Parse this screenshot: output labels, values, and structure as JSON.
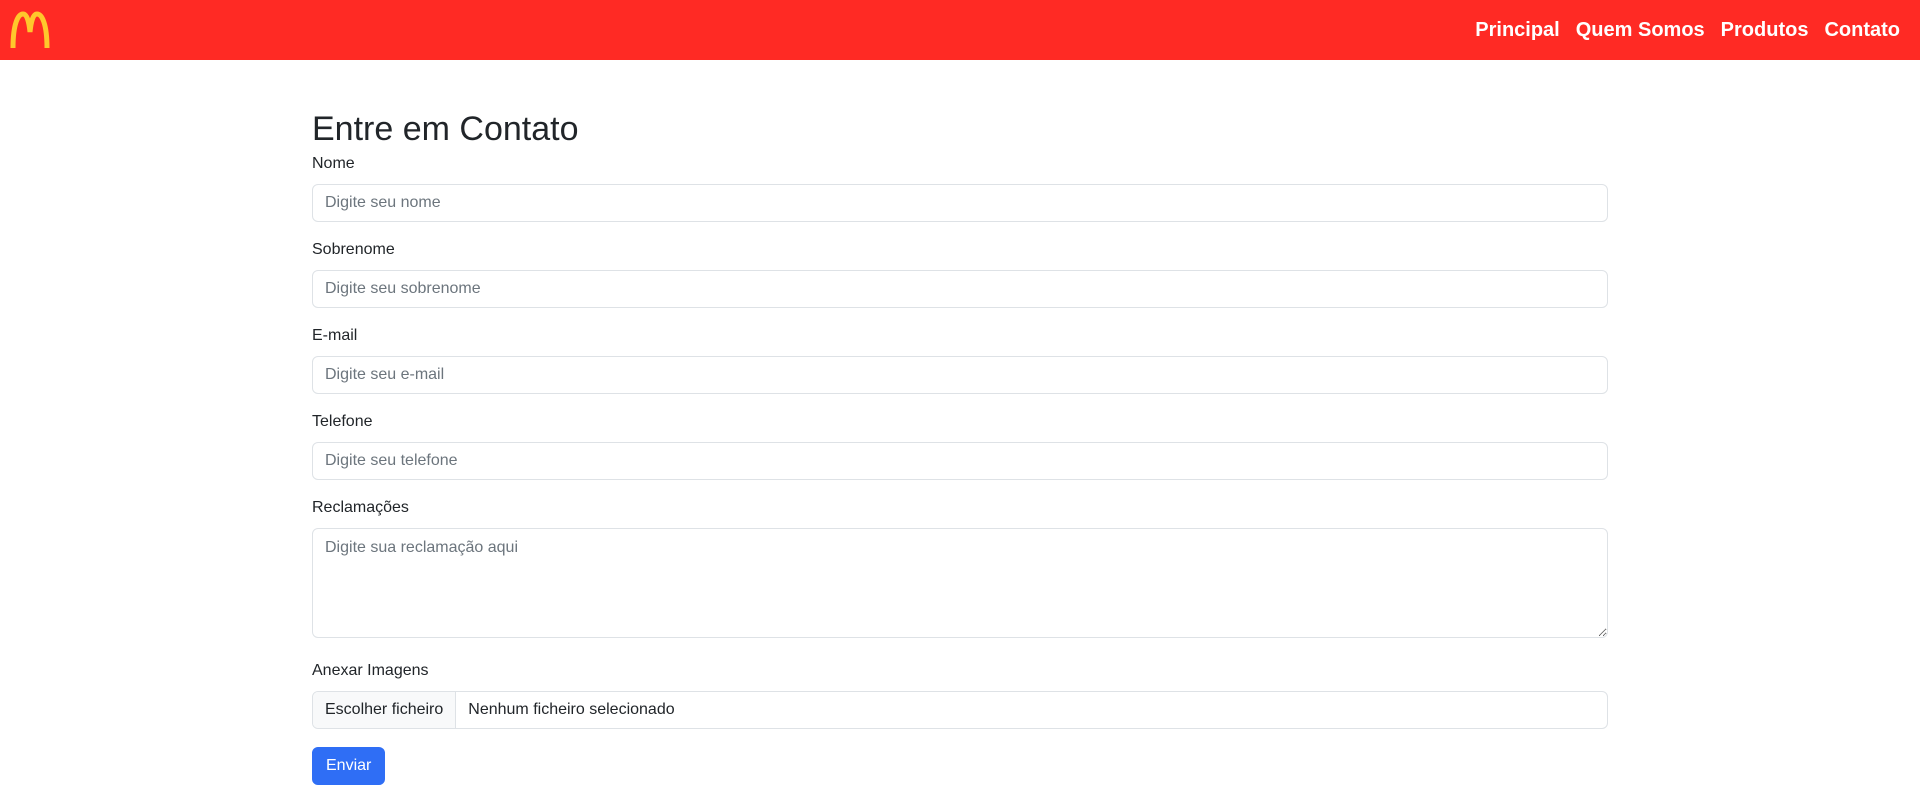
{
  "colors": {
    "navbar_bg": "#ff2a24",
    "logo": "#ffc72c",
    "primary_button": "#2f6ef5"
  },
  "navbar": {
    "logo_icon": "mcdonalds-arches-icon",
    "links": [
      "Principal",
      "Quem Somos",
      "Produtos",
      "Contato"
    ]
  },
  "form": {
    "title": "Entre em Contato",
    "fields": {
      "nome": {
        "label": "Nome",
        "placeholder": "Digite seu nome"
      },
      "sobrenome": {
        "label": "Sobrenome",
        "placeholder": "Digite seu sobrenome"
      },
      "email": {
        "label": "E-mail",
        "placeholder": "Digite seu e-mail"
      },
      "telefone": {
        "label": "Telefone",
        "placeholder": "Digite seu telefone"
      },
      "reclamacoes": {
        "label": "Reclamações",
        "placeholder": "Digite sua reclamação aqui"
      },
      "anexo": {
        "label": "Anexar Imagens",
        "button": "Escolher ficheiro",
        "status": "Nenhum ficheiro selecionado"
      }
    },
    "submit_label": "Enviar"
  }
}
